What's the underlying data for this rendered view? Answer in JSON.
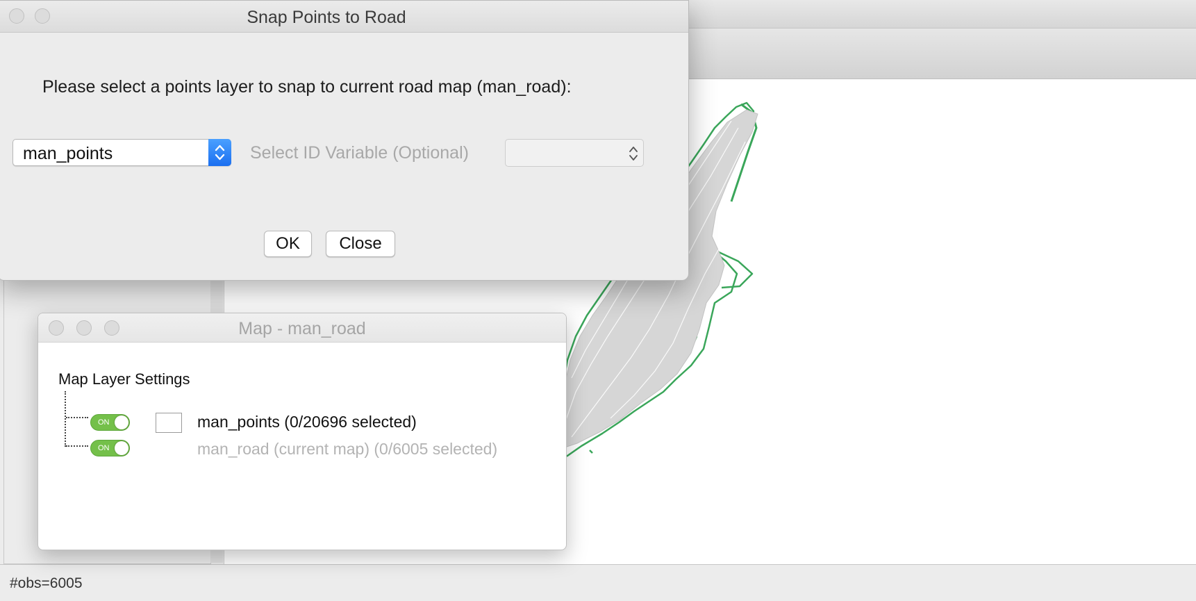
{
  "snap_dialog": {
    "title": "Snap Points to Road",
    "prompt": "Please select a points layer to snap to current road map (man_road):",
    "points_layer_value": "man_points",
    "id_variable_label": "Select ID Variable (Optional)",
    "id_variable_value": "",
    "ok_label": "OK",
    "close_label": "Close"
  },
  "layer_window": {
    "title": "Map - man_road",
    "heading": "Map Layer Settings",
    "layers": [
      {
        "label": "man_points (0/20696 selected)",
        "toggle": "ON"
      },
      {
        "label": "man_road (current map) (0/6005 selected)",
        "toggle": "ON"
      }
    ]
  },
  "status_bar": {
    "text": "#obs=6005"
  },
  "colors": {
    "road_lines": "#3aa65a",
    "points_fill": "#d0d0d0",
    "toggle_on": "#74c04a",
    "select_accent": "#1b6ff0"
  }
}
